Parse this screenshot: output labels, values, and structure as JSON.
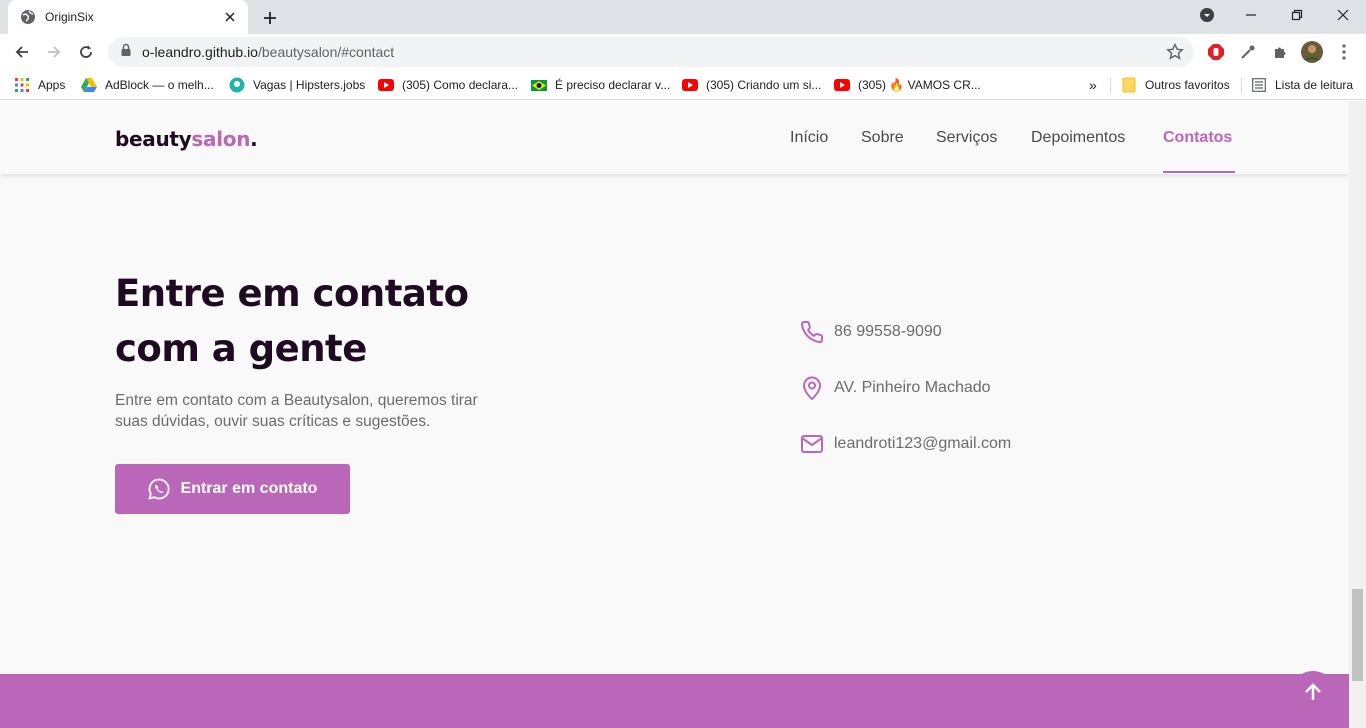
{
  "browser": {
    "tab_title": "OriginSix",
    "url_host": "o-leandro.github.io",
    "url_path": "/beautysalon/#contact",
    "bookmarks": [
      {
        "label": "Apps"
      },
      {
        "label": "AdBlock — o melh..."
      },
      {
        "label": "Vagas | Hipsters.jobs"
      },
      {
        "label": "(305) Como declara..."
      },
      {
        "label": "É preciso declarar v..."
      },
      {
        "label": "(305) Criando um si..."
      },
      {
        "label": "(305) 🔥 VAMOS CR..."
      }
    ],
    "bookmarks_overflow": "»",
    "other_favorites": "Outros favoritos",
    "reading_list": "Lista de leitura"
  },
  "site": {
    "logo_main": "beauty",
    "logo_accent": "salon",
    "logo_dot": ".",
    "menu": [
      "Início",
      "Sobre",
      "Serviços",
      "Depoimentos",
      "Contatos"
    ],
    "active_menu": "Contatos"
  },
  "contact": {
    "title_line1": "Entre em contato",
    "title_line2": "com a gente",
    "text_line1": "Entre em contato com a Beautysalon, queremos tirar",
    "text_line2": "suas dúvidas, ouvir suas críticas e sugestões.",
    "button_label": "Entrar em contato",
    "phone": "86 99558-9090",
    "address": "AV. Pinheiro Machado",
    "email": "leandroti123@gmail.com"
  },
  "icons": {
    "phone": "phone-icon",
    "location": "map-pin-icon",
    "email": "mail-icon",
    "whatsapp": "whatsapp-icon",
    "back_to_top": "arrow-up-icon"
  },
  "colors": {
    "accent": "#bb67b9",
    "heading": "#1f0b21",
    "text": "#6c6c6c",
    "background": "#f9f9f9"
  }
}
